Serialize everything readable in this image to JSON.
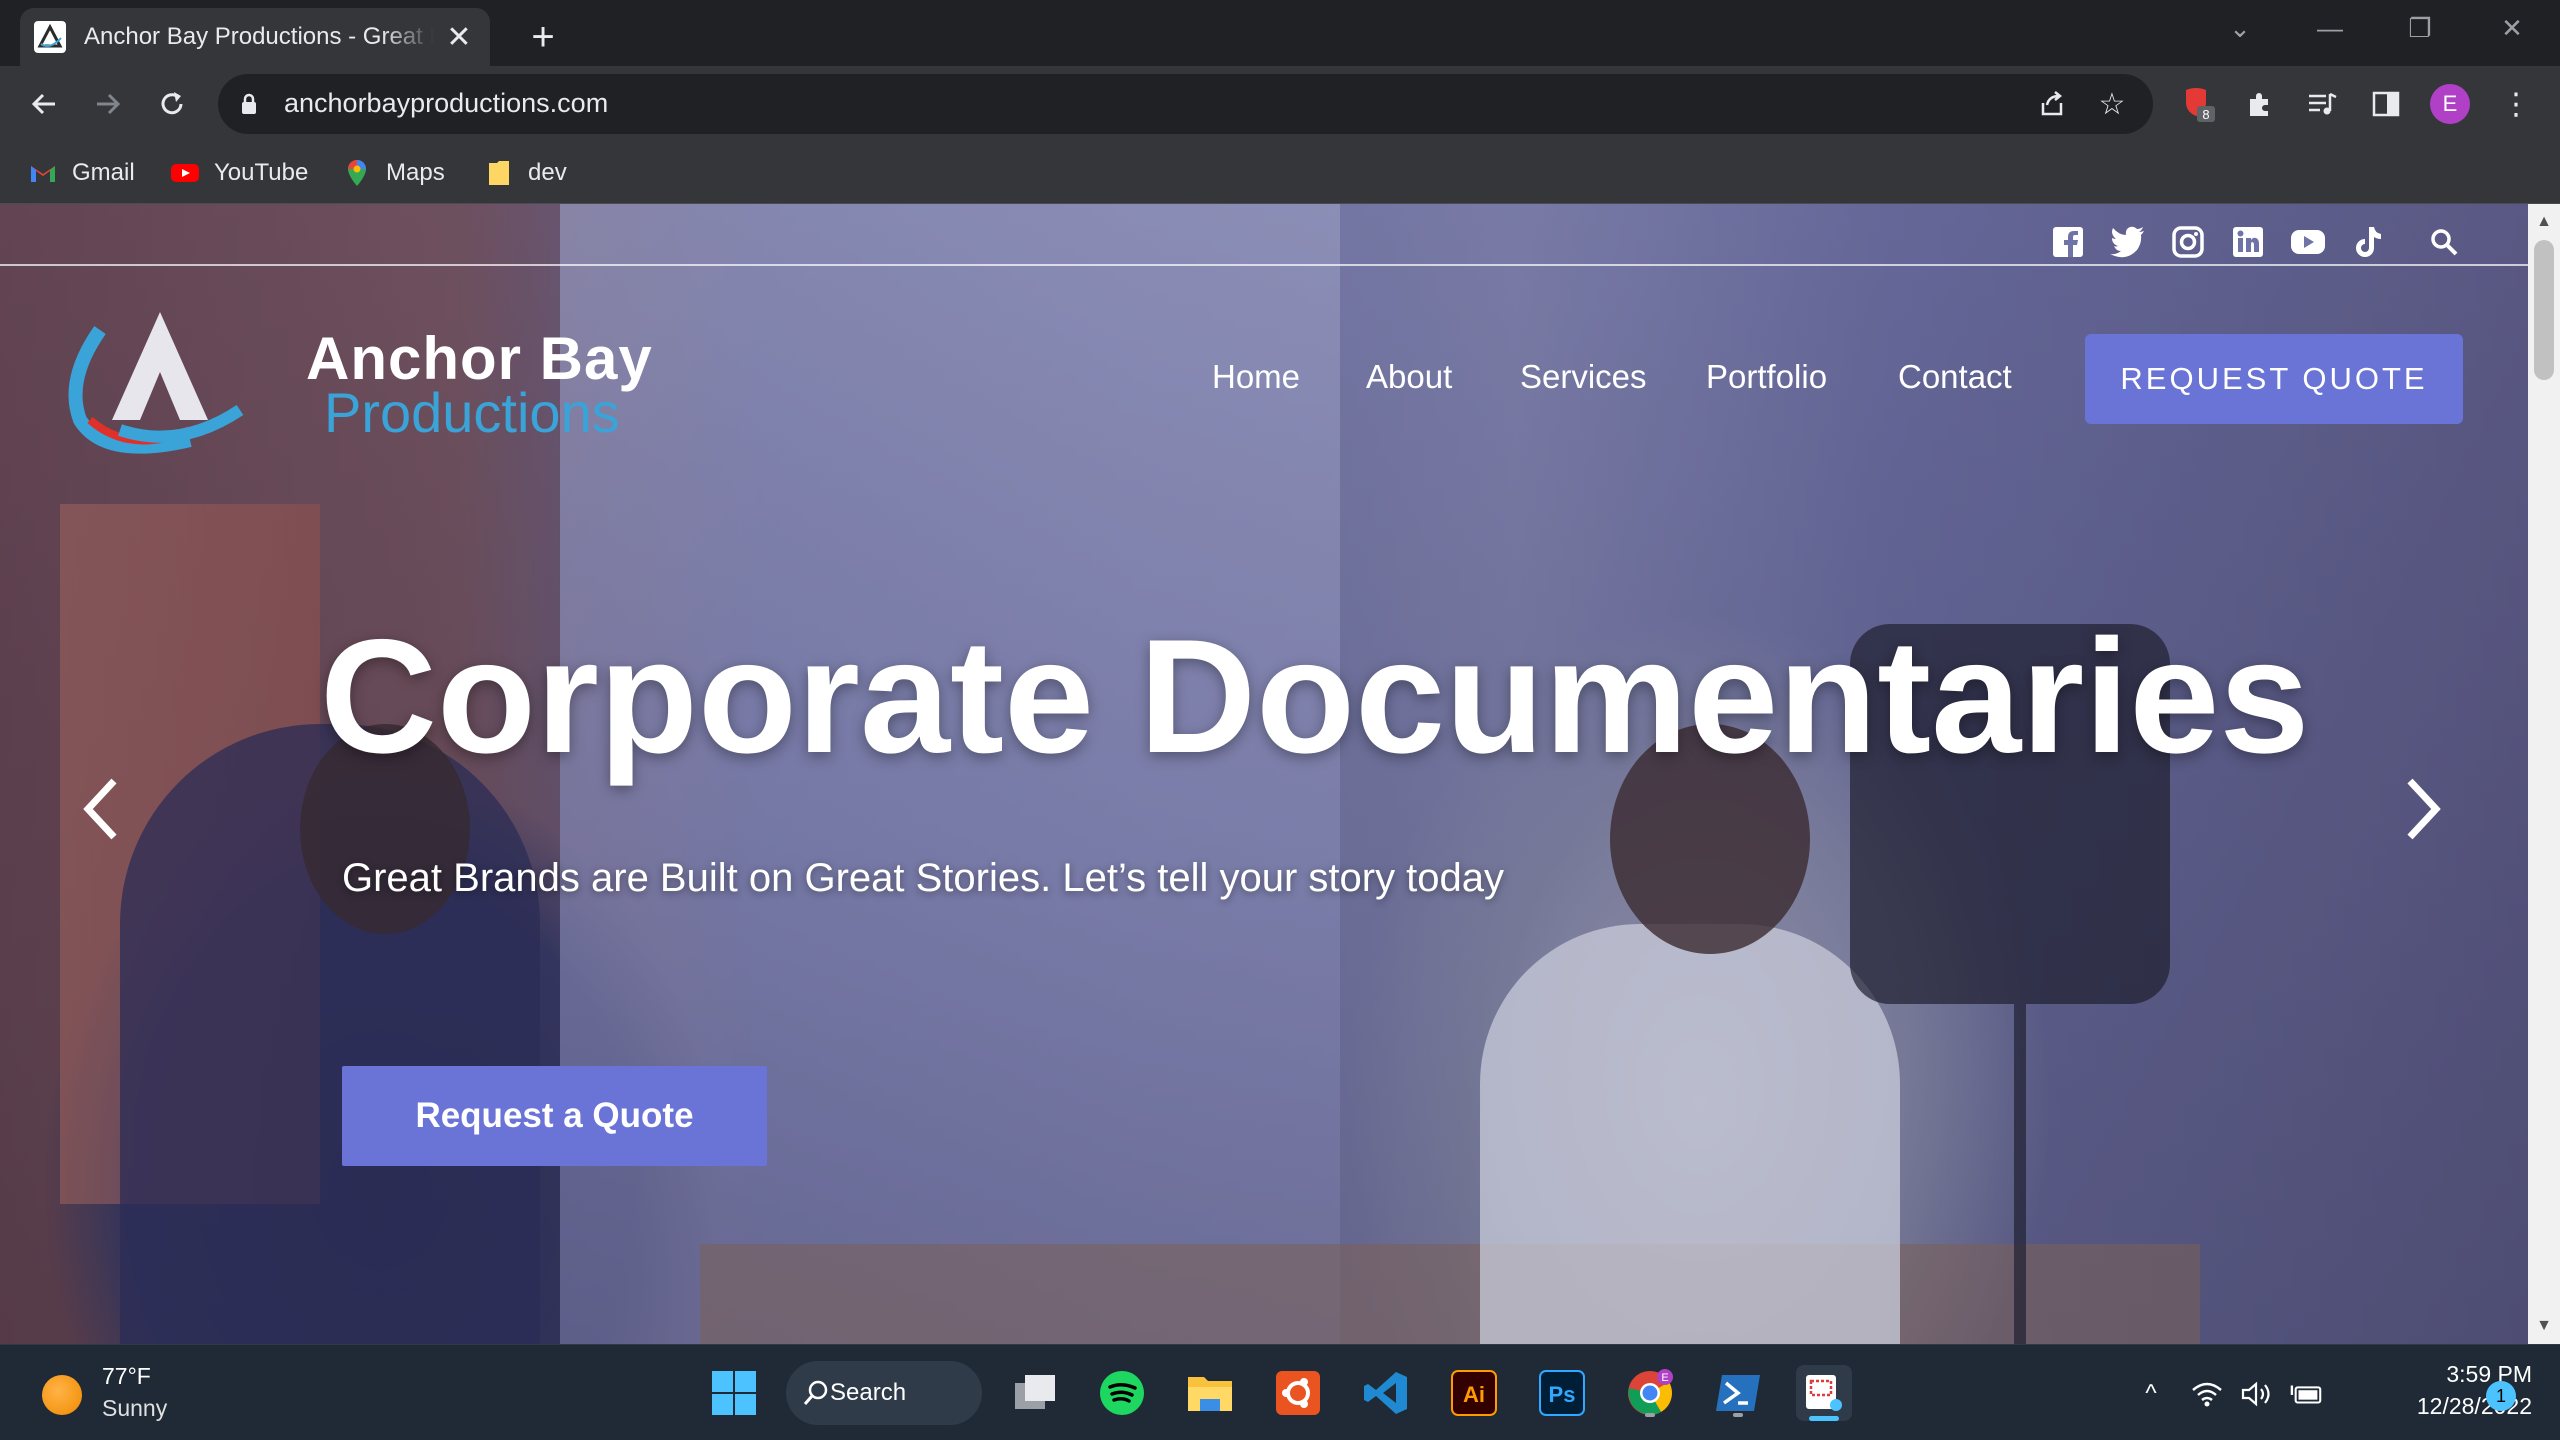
{
  "browser": {
    "tab": {
      "title": "Anchor Bay Productions - Great B",
      "close": "✕"
    },
    "new_tab": "+",
    "url": "anchorbayproductions.com",
    "extension_badge": "8",
    "profile_initial": "E"
  },
  "bookmarks": [
    {
      "label": "Gmail",
      "icon": "gmail-icon"
    },
    {
      "label": "YouTube",
      "icon": "youtube-icon"
    },
    {
      "label": "Maps",
      "icon": "maps-icon"
    },
    {
      "label": "dev",
      "icon": "folder-icon"
    }
  ],
  "site": {
    "logo": {
      "line1": "Anchor Bay",
      "line2": "Productions"
    },
    "social": [
      "facebook-icon",
      "twitter-icon",
      "instagram-icon",
      "linkedin-icon",
      "youtube-icon",
      "tiktok-icon",
      "search-icon"
    ],
    "nav": [
      "Home",
      "About",
      "Services",
      "Portfolio",
      "Contact"
    ],
    "request_quote_label": "REQUEST QUOTE",
    "hero": {
      "title": "Corporate Documentaries",
      "subtitle": "Great Brands are Built on Great Stories. Let’s tell your story today",
      "cta": "Request a Quote"
    }
  },
  "taskbar": {
    "weather": {
      "temp": "77°F",
      "condition": "Sunny"
    },
    "search_label": "Search",
    "clock": {
      "time": "3:59 PM",
      "date": "12/28/2022"
    },
    "notification_count": "1",
    "chrome_badge": "E"
  },
  "colors": {
    "accent_button": "#6a74d6",
    "logo_blue": "#3aa3d8",
    "taskbar_bg": "#1f2a36",
    "chrome_bg": "#35363a"
  }
}
